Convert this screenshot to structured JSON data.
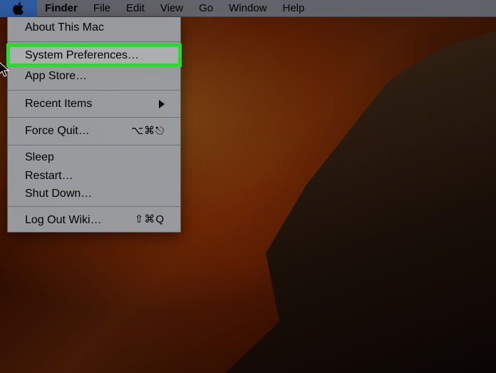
{
  "menubar": {
    "app_name": "Finder",
    "items": [
      "File",
      "Edit",
      "View",
      "Go",
      "Window",
      "Help"
    ]
  },
  "apple_menu": {
    "about": "About This Mac",
    "system_prefs": "System Preferences…",
    "app_store": "App Store…",
    "recent_items": "Recent Items",
    "force_quit": "Force Quit…",
    "force_quit_shortcut": "⌥⌘⎋",
    "sleep": "Sleep",
    "restart": "Restart…",
    "shut_down": "Shut Down…",
    "log_out": "Log Out Wiki…",
    "log_out_shortcut": "⇧⌘Q"
  }
}
